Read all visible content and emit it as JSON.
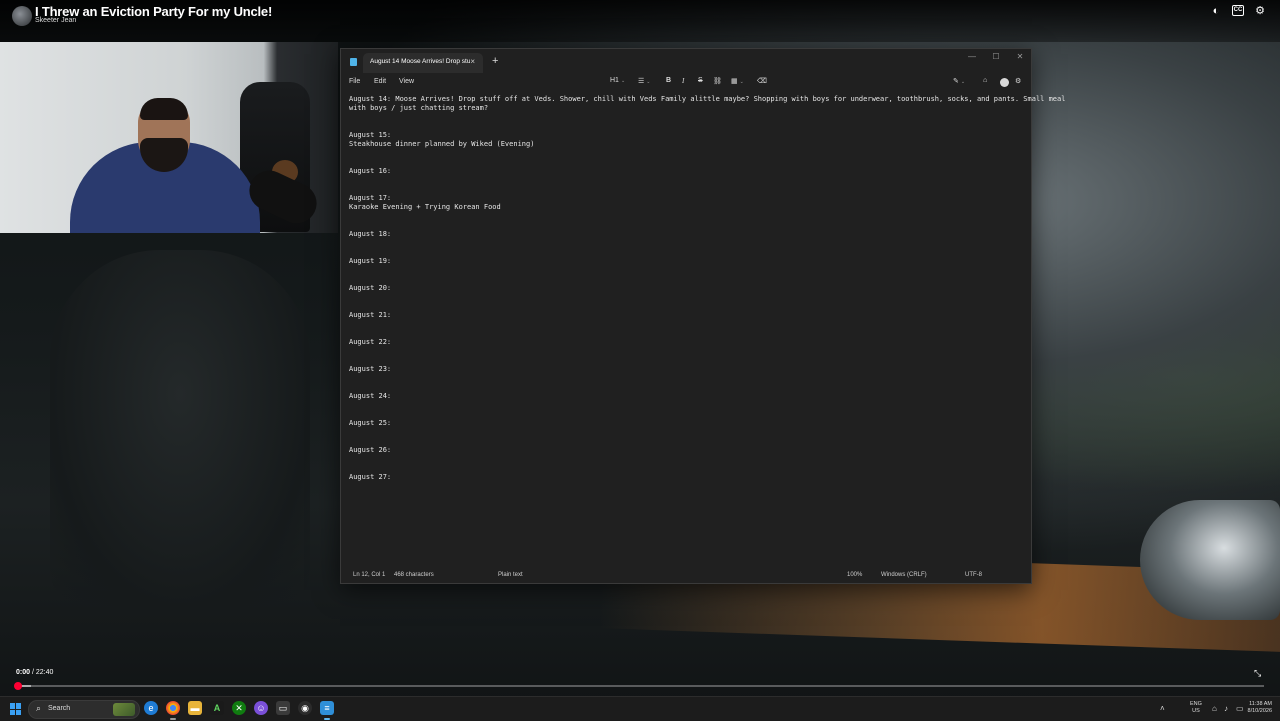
{
  "video": {
    "title": "I Threw an Eviction Party For my Uncle!",
    "channel": "Skeeter Jean",
    "time_current": "0:00",
    "time_separator": " / ",
    "time_total": "22:40",
    "progress": 0.0,
    "buffered": 0.012,
    "top_icons": [
      "brightness-icon",
      "captions-icon",
      "settings-icon"
    ],
    "captions_label": "CC"
  },
  "notepad": {
    "tab_title": "August 14 Moose Arrives! Drop stu",
    "menu": [
      "File",
      "Edit",
      "View"
    ],
    "toolbar": {
      "heading": "H1",
      "bold": "B",
      "italic": "I",
      "strike": "S"
    },
    "lines": [
      "August 14: Moose Arrives! Drop stuff off at Veds. Shower, chill with Veds Family alittle maybe? Shopping with boys for underwear, toothbrush, socks, and pants. Small meal",
      "with boys / just chatting stream?",
      "August 15:",
      "Steakhouse dinner planned by Wiked (Evening)",
      "August 16:",
      "August 17:",
      "Karaoke Evening + Trying Korean Food",
      "August 18:",
      "August 19:",
      "August 20:",
      "August 21:",
      "August 22:",
      "August 23:",
      "August 24:",
      "August 25:",
      "August 26:",
      "August 27:"
    ],
    "status": {
      "position": "Ln 12, Col 1",
      "characters": "468 characters",
      "format": "Plain text",
      "zoom": "100%",
      "line_ending": "Windows (CRLF)",
      "encoding": "UTF-8"
    }
  },
  "taskbar": {
    "search_placeholder": "Search",
    "language_top": "ENG",
    "language_bottom": "US",
    "time": "11:38 AM",
    "date": "8/10/2026",
    "accent": "#3aa0f3"
  }
}
